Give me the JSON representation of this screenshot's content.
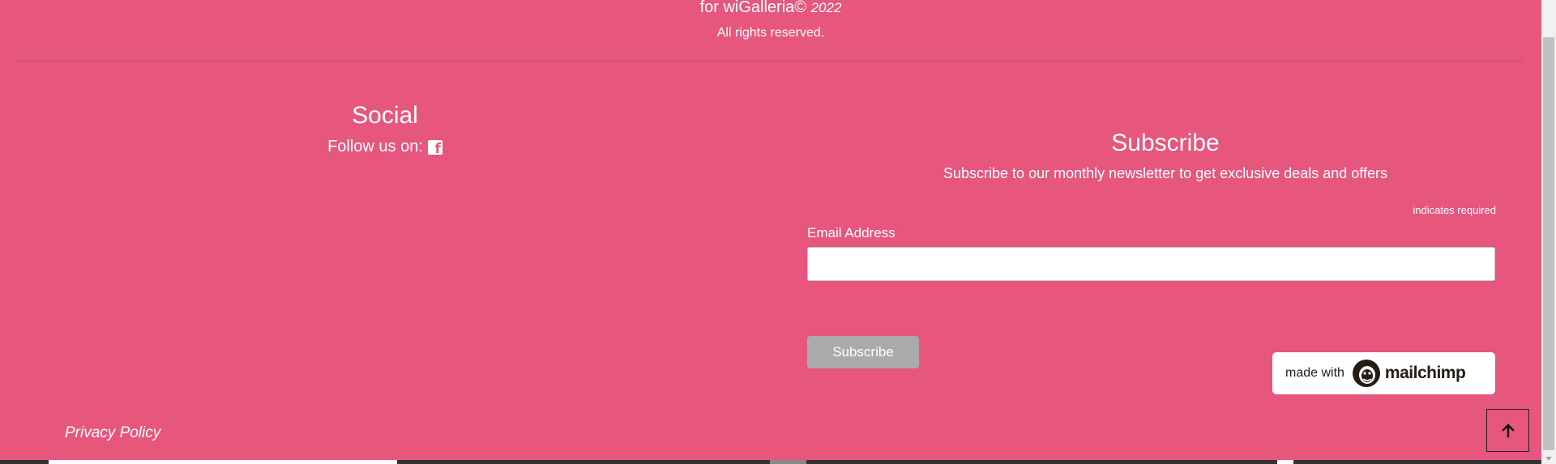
{
  "footer": {
    "copyright_prefix": "for wiGalleria©",
    "copyright_year": "2022",
    "rights": "All rights reserved."
  },
  "social": {
    "title": "Social",
    "follow_label": "Follow us on:",
    "icon": "facebook-icon"
  },
  "subscribe": {
    "title": "Subscribe",
    "description": "Subscribe to our monthly newsletter to get exclusive deals and offers",
    "required_star": "*",
    "required_note": "indicates required",
    "email_label": "Email Address",
    "email_star": "*",
    "email_value": "",
    "button_label": "Subscribe"
  },
  "badge": {
    "made_with": "made with",
    "brand": "mailchimp",
    "icon": "mailchimp-logo-icon"
  },
  "links": {
    "privacy": "Privacy Policy"
  },
  "back_to_top": {
    "icon": "arrow-up-icon"
  },
  "colors": {
    "background": "#e6567d",
    "required": "#e85c5c",
    "button_disabled": "#aaaaaa"
  }
}
